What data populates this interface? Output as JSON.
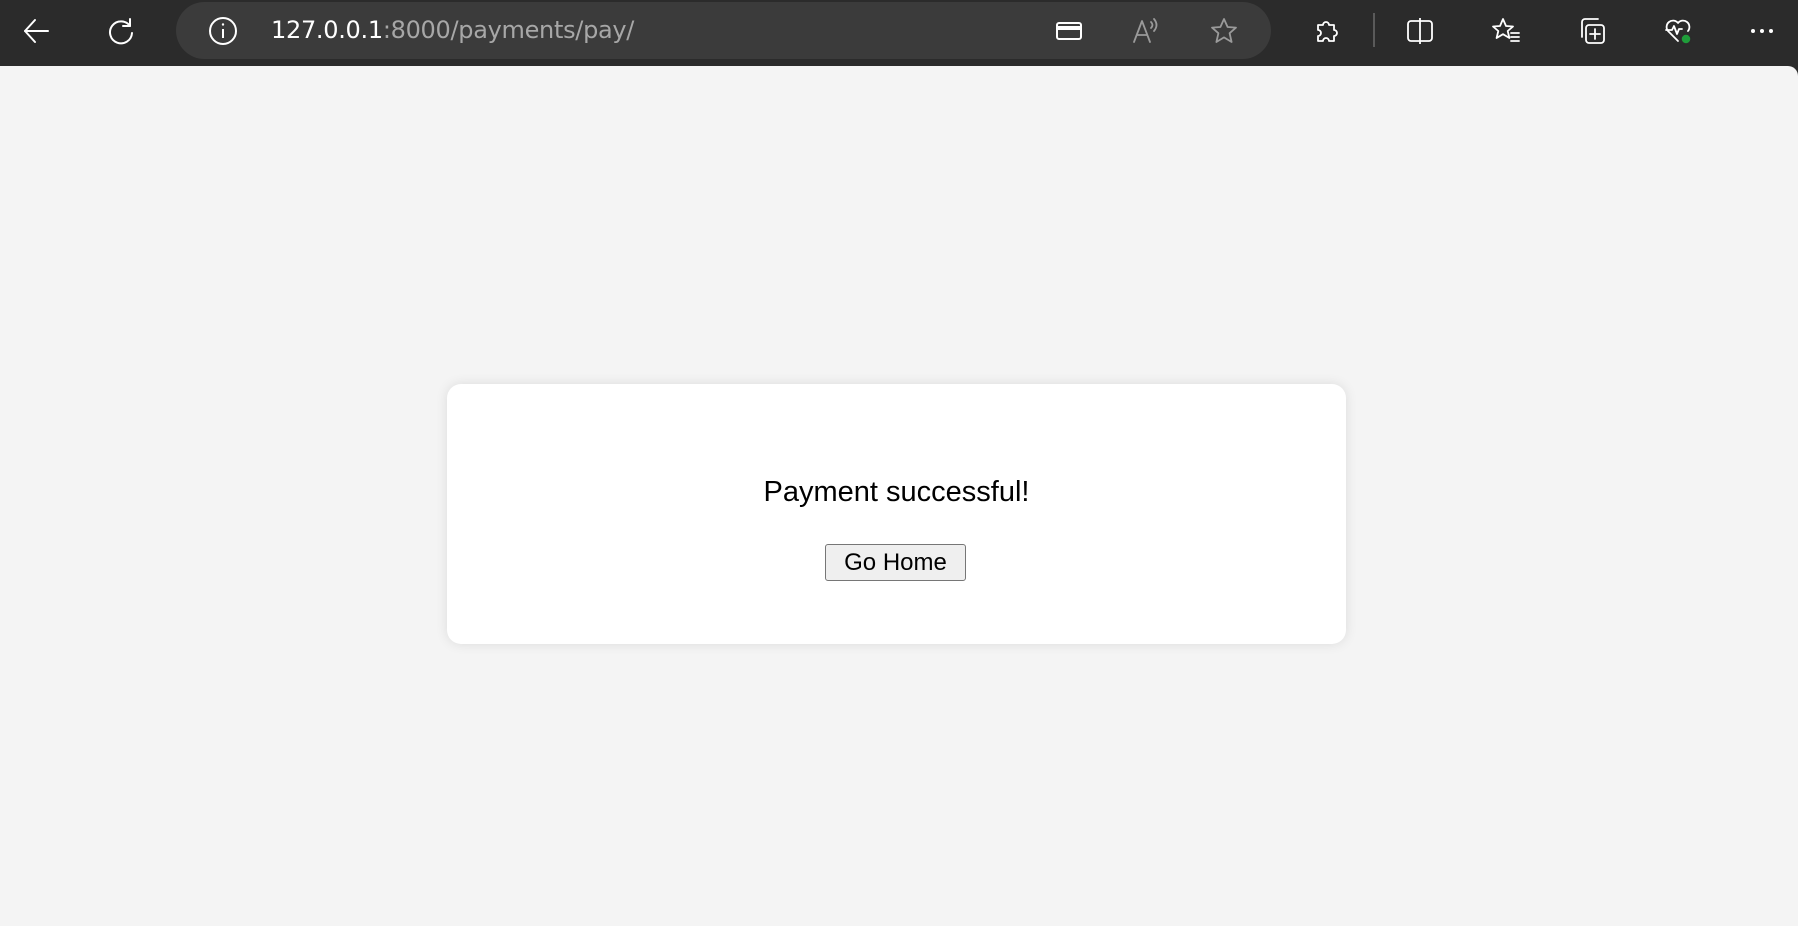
{
  "browser": {
    "url_host": "127.0.0.1",
    "url_rest": ":8000/payments/pay/",
    "toolbar_icons": {
      "back": "back-arrow-icon",
      "reload": "reload-icon",
      "site_info": "info-icon",
      "card": "payment-card-icon",
      "read_aloud": "read-aloud-icon",
      "favorite": "star-icon",
      "extensions": "extensions-puzzle-icon",
      "split_screen": "split-screen-icon",
      "favorites": "favorites-list-icon",
      "collections": "collections-icon",
      "browser_essentials": "heart-pulse-icon",
      "more": "more-dots-icon"
    }
  },
  "colors": {
    "toolbar_bg": "#2b2b2b",
    "page_bg": "#f4f4f4",
    "card_bg": "#ffffff",
    "status_badge": "#1f9d3a"
  },
  "page": {
    "message": "Payment successful!",
    "button_label": "Go Home"
  }
}
